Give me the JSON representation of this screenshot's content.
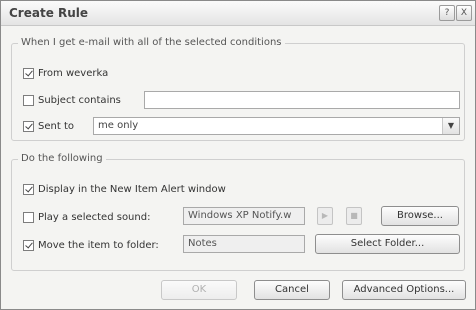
{
  "window": {
    "title": "Create Rule"
  },
  "titlebar_buttons": [
    "?",
    "X"
  ],
  "conditions": {
    "legend": "When I get e-mail with all of the selected conditions",
    "from": {
      "label": "From weverka",
      "checked": true
    },
    "subject": {
      "label": "Subject contains",
      "checked": false,
      "value": ""
    },
    "sent_to": {
      "label": "Sent to",
      "checked": true,
      "value": "me only"
    }
  },
  "actions": {
    "legend": "Do the following",
    "display_alert": {
      "label": "Display in the New Item Alert window",
      "checked": true
    },
    "play_sound": {
      "label": "Play a selected sound:",
      "checked": false,
      "value": "Windows XP Notify.w",
      "browse_label": "Browse..."
    },
    "move_item": {
      "label": "Move the item to folder:",
      "checked": true,
      "value": "Notes",
      "select_label": "Select Folder..."
    }
  },
  "footer": {
    "ok_label": "OK",
    "cancel_label": "Cancel",
    "advanced_label": "Advanced Options..."
  }
}
